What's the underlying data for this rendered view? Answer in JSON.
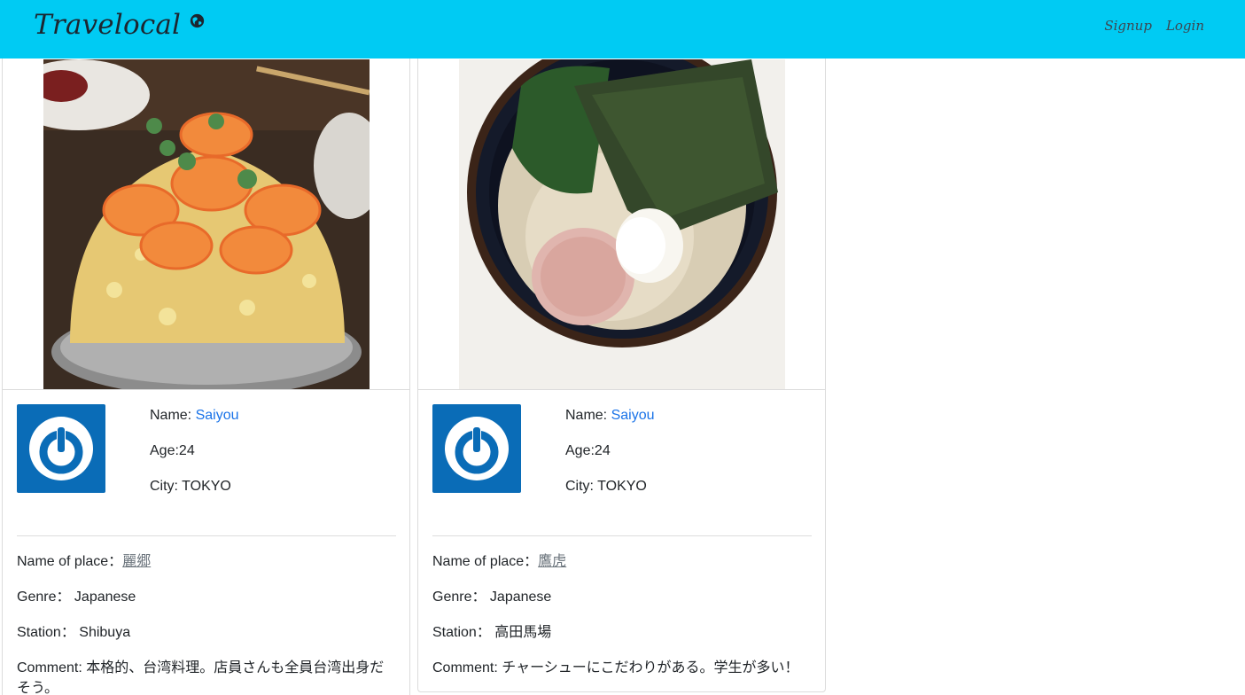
{
  "navbar": {
    "brand": "Travelocal",
    "signup": "Signup",
    "login": "Login",
    "brand_color": "#00cbf3"
  },
  "labels": {
    "name": "Name: ",
    "age_prefix": "Age:",
    "city_prefix": "City: ",
    "place": "Name of place：",
    "genre": "Genre： ",
    "station": "Station： ",
    "comment": "Comment: "
  },
  "posts": [
    {
      "photo_icon": "shrimp-fried-rice-photo",
      "user": "Saiyou",
      "age": "24",
      "city": "TOKYO",
      "place": "麗郷",
      "genre": "Japanese",
      "station": "Shibuya",
      "comment": "本格的、台湾料理。店員さんも全員台湾出身だそう。"
    },
    {
      "photo_icon": "ramen-photo",
      "user": "Saiyou",
      "age": "24",
      "city": "TOKYO",
      "place": "鷹虎",
      "genre": "Japanese",
      "station": "高田馬場",
      "comment": "チャーシューにこだわりがある。学生が多い！"
    }
  ]
}
